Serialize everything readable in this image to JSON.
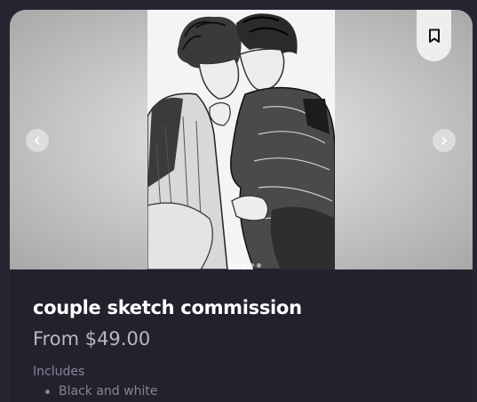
{
  "product": {
    "title": "couple sketch commission",
    "price": "From $49.00",
    "includes_label": "Includes",
    "includes": [
      "Black and white"
    ]
  },
  "gallery": {
    "image_count": 5,
    "active_index": 0,
    "image_description": "black and white pencil sketch of a couple embracing"
  },
  "icons": {
    "prev": "chevron-left-icon",
    "next": "chevron-right-icon",
    "save": "bookmark-icon"
  },
  "colors": {
    "page_background": "#262633",
    "card_background": "#22222d",
    "title_text": "#ffffff",
    "price_text": "#b8b8c4",
    "muted_text": "#85859a"
  }
}
